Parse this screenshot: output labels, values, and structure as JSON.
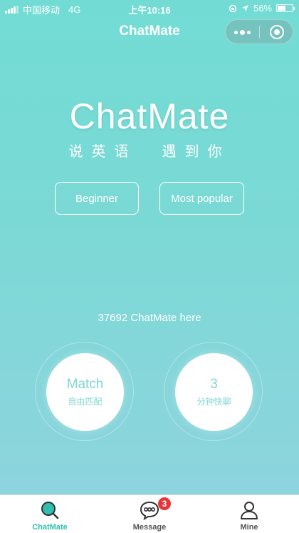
{
  "status_bar": {
    "carrier": "中国移动",
    "network": "4G",
    "time": "上午10:16",
    "battery": "56%",
    "battery_level": 0.56
  },
  "nav": {
    "title": "ChatMate"
  },
  "hero": {
    "brand": "ChatMate",
    "slogan": "说英语  遇到你"
  },
  "levels": {
    "beginner": "Beginner",
    "popular": "Most popular"
  },
  "online_text": "37692 ChatMate here",
  "actions": {
    "match_main": "Match",
    "match_sub": "自由匹配",
    "quick_main": "3",
    "quick_sub": "分钟快聊"
  },
  "tabs": [
    {
      "label": "ChatMate",
      "icon": "search-icon",
      "active": true
    },
    {
      "label": "Message",
      "icon": "message-icon",
      "badge": "3"
    },
    {
      "label": "Mine",
      "icon": "user-icon"
    }
  ],
  "colors": {
    "accent": "#2fbfb0",
    "badge": "#e8353a",
    "gradient_top": "#72dcd4",
    "gradient_bottom": "#8ed4de"
  }
}
